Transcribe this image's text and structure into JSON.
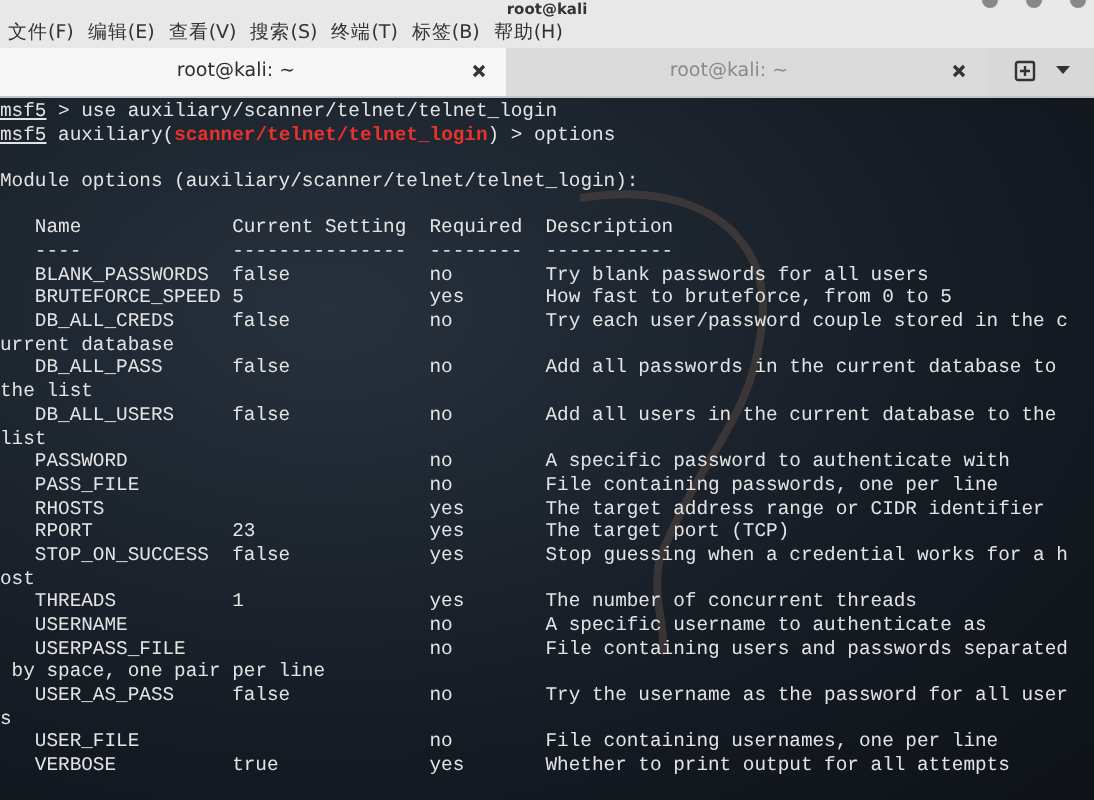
{
  "window": {
    "title": "root@kali"
  },
  "menu": [
    "文件(F)",
    "编辑(E)",
    "查看(V)",
    "搜索(S)",
    "终端(T)",
    "标签(B)",
    "帮助(H)"
  ],
  "tabs": [
    {
      "label": "root@kali: ~",
      "selected": true
    },
    {
      "label": "root@kali: ~",
      "selected": false
    }
  ],
  "terminal": {
    "commands": [
      [
        {
          "kind": "prompt",
          "text": "msf5"
        },
        {
          "kind": "plain",
          "text": " > use auxiliary/scanner/telnet/telnet_login"
        }
      ],
      [
        {
          "kind": "prompt",
          "text": "msf5"
        },
        {
          "kind": "plain",
          "text": " auxiliary("
        },
        {
          "kind": "module",
          "text": "scanner/telnet/telnet_login"
        },
        {
          "kind": "plain",
          "text": ") > options"
        }
      ]
    ],
    "heading": "Module options (auxiliary/scanner/telnet/telnet_login):",
    "columns": [
      {
        "label": "Name",
        "rule": "----"
      },
      {
        "label": "Current Setting",
        "rule": "---------------"
      },
      {
        "label": "Required",
        "rule": "--------"
      },
      {
        "label": "Description",
        "rule": "-----------"
      }
    ],
    "rows": [
      {
        "name": "BLANK_PASSWORDS",
        "setting": "false",
        "required": "no",
        "description": "Try blank passwords for all users"
      },
      {
        "name": "BRUTEFORCE_SPEED",
        "setting": "5",
        "required": "yes",
        "description": "How fast to bruteforce, from 0 to 5"
      },
      {
        "name": "DB_ALL_CREDS",
        "setting": "false",
        "required": "no",
        "description": "Try each user/password couple stored in the c",
        "wrap": "urrent database"
      },
      {
        "name": "DB_ALL_PASS",
        "setting": "false",
        "required": "no",
        "description": "Add all passwords in the current database to",
        "wrap": "the list"
      },
      {
        "name": "DB_ALL_USERS",
        "setting": "false",
        "required": "no",
        "description": "Add all users in the current database to the",
        "wrap": "list"
      },
      {
        "name": "PASSWORD",
        "required": "no",
        "description": "A specific password to authenticate with"
      },
      {
        "name": "PASS_FILE",
        "required": "no",
        "description": "File containing passwords, one per line"
      },
      {
        "name": "RHOSTS",
        "required": "yes",
        "description": "The target address range or CIDR identifier"
      },
      {
        "name": "RPORT",
        "setting": "23",
        "required": "yes",
        "description": "The target port (TCP)"
      },
      {
        "name": "STOP_ON_SUCCESS",
        "setting": "false",
        "required": "yes",
        "description": "Stop guessing when a credential works for a h",
        "wrap": "ost"
      },
      {
        "name": "THREADS",
        "setting": "1",
        "required": "yes",
        "description": "The number of concurrent threads"
      },
      {
        "name": "USERNAME",
        "required": "no",
        "description": "A specific username to authenticate as"
      },
      {
        "name": "USERPASS_FILE",
        "required": "no",
        "description": "File containing users and passwords separated",
        "wrap": " by space, one pair per line"
      },
      {
        "name": "USER_AS_PASS",
        "setting": "false",
        "required": "no",
        "description": "Try the username as the password for all user",
        "wrap": "s"
      },
      {
        "name": "USER_FILE",
        "required": "no",
        "description": "File containing usernames, one per line"
      },
      {
        "name": "VERBOSE",
        "setting": "true",
        "required": "yes",
        "description": "Whether to print output for all attempts"
      }
    ]
  }
}
